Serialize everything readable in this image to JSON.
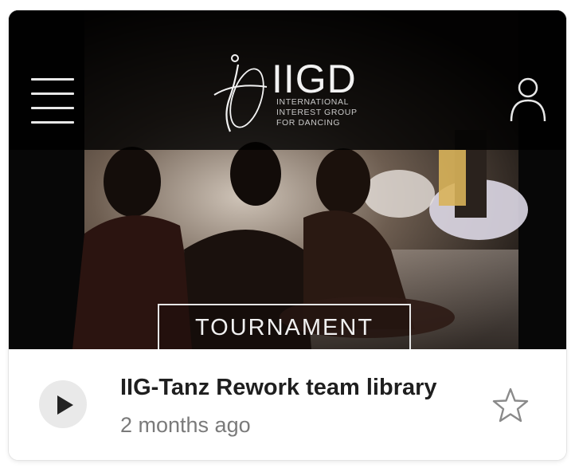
{
  "card": {
    "thumbnail": {
      "logo": {
        "title": "IIGD",
        "subtitle_lines": [
          "INTERNATIONAL",
          "INTEREST GROUP",
          "FOR DANCING"
        ]
      },
      "banner_text": "TOURNAMENT",
      "icons": {
        "menu": "hamburger-menu-icon",
        "user": "user-profile-icon"
      }
    },
    "file": {
      "title": "IIG-Tanz Rework team library",
      "modified": "2 months ago"
    },
    "actions": {
      "play": "play-icon",
      "favorite": "star-outline-icon"
    },
    "colors": {
      "thumbnail_bg": "#0b0b0b",
      "title_text": "#1f1f1f",
      "meta_text": "#7a7a7a",
      "play_bg": "#e9e9e9"
    }
  }
}
